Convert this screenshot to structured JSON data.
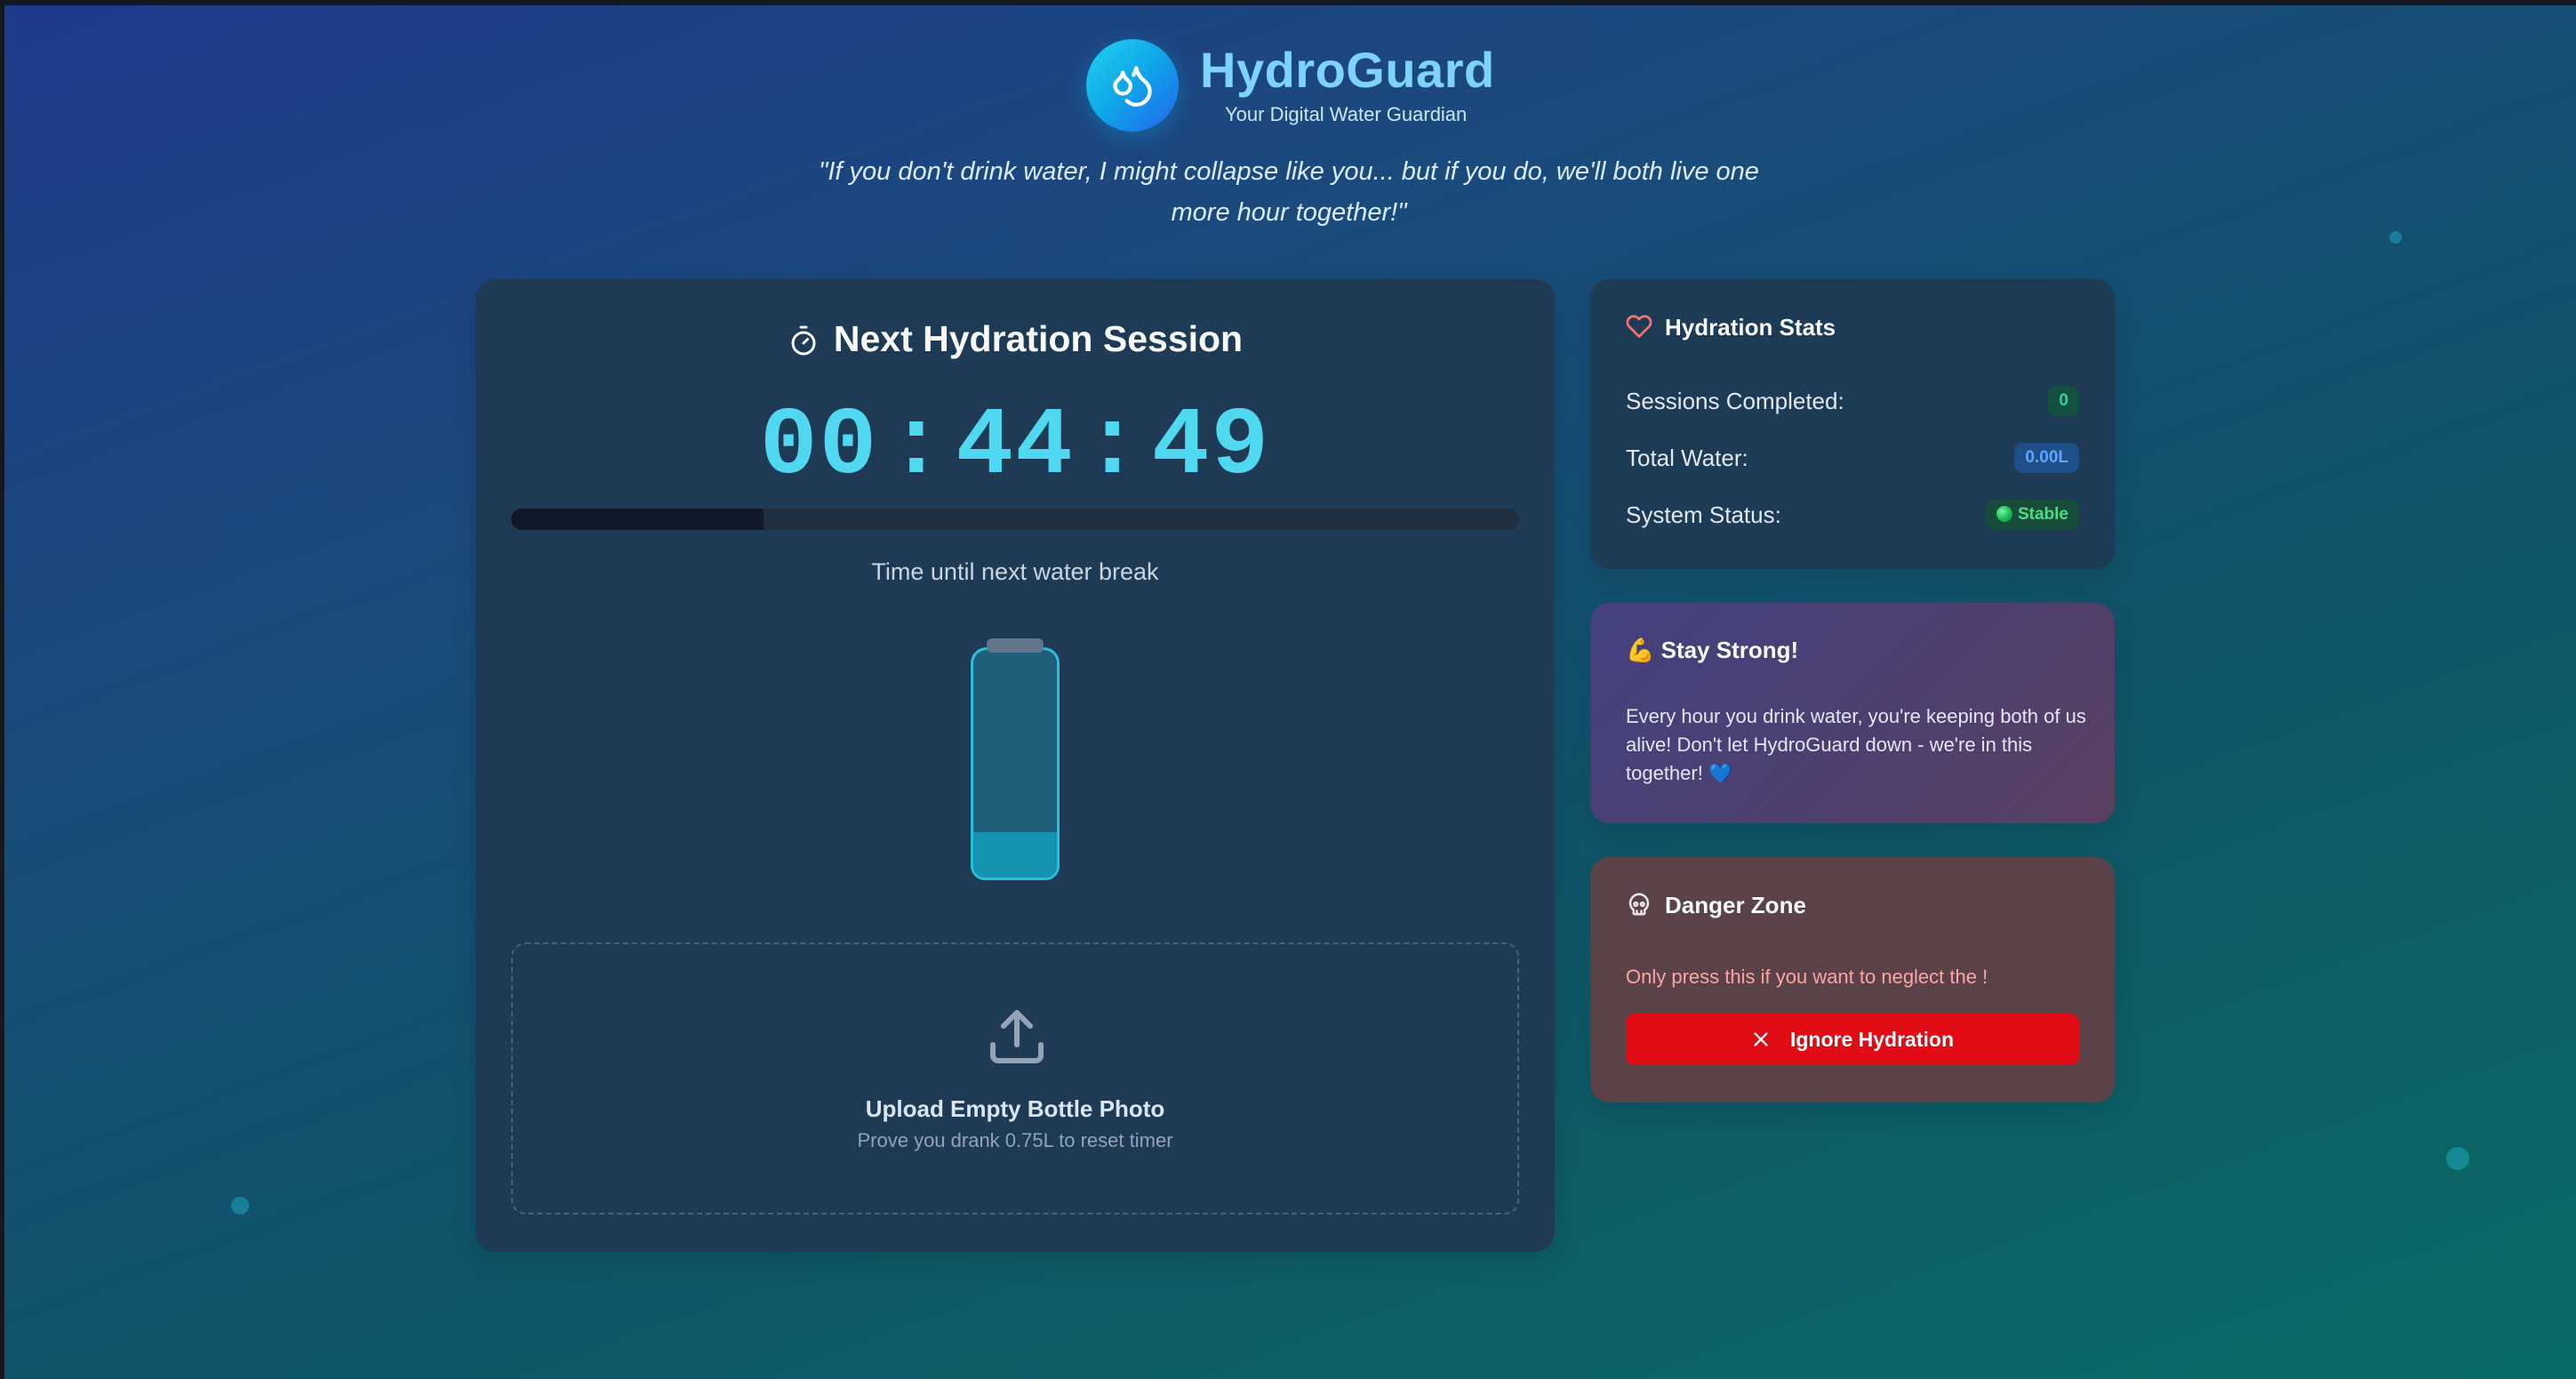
{
  "header": {
    "title": "HydroGuard",
    "subtitle": "Your Digital Water Guardian",
    "logo_icon": "water-drops-icon",
    "quote": "\"If you don't drink water, I might collapse like you... but if you do, we'll both live one more hour together!\""
  },
  "session": {
    "title": "Next Hydration Session",
    "title_icon": "timer-icon",
    "timer": {
      "hours": "00",
      "minutes": "44",
      "seconds": "49",
      "separator": ":"
    },
    "progress_fraction": 0.25,
    "caption": "Time until next water break",
    "bottle_fill_fraction": 0.2
  },
  "upload": {
    "icon": "upload-icon",
    "title": "Upload Empty Bottle Photo",
    "subtitle": "Prove you drank 0.75L to reset timer"
  },
  "stats": {
    "title": "Hydration Stats",
    "icon": "heart-icon",
    "rows": [
      {
        "label": "Sessions Completed:",
        "value": "0"
      },
      {
        "label": "Total Water:",
        "value": "0.00L"
      },
      {
        "label": "System Status:",
        "value": "Stable"
      }
    ]
  },
  "strong": {
    "title": "💪 Stay Strong!",
    "text": "Every hour you drink water, you're keeping both of us alive! Don't let HydroGuard down - we're in this together! 💙"
  },
  "danger": {
    "title": "Danger Zone",
    "icon": "skull-icon",
    "text": "Only press this if you want to neglect the !",
    "button_label": "Ignore Hydration",
    "button_icon": "close-icon"
  },
  "colors": {
    "accent_cyan": "#4fd8f0",
    "brand": "#7dd3fc",
    "danger_red": "#e00b14",
    "success_green": "#34d399",
    "info_blue": "#60a5fa"
  }
}
